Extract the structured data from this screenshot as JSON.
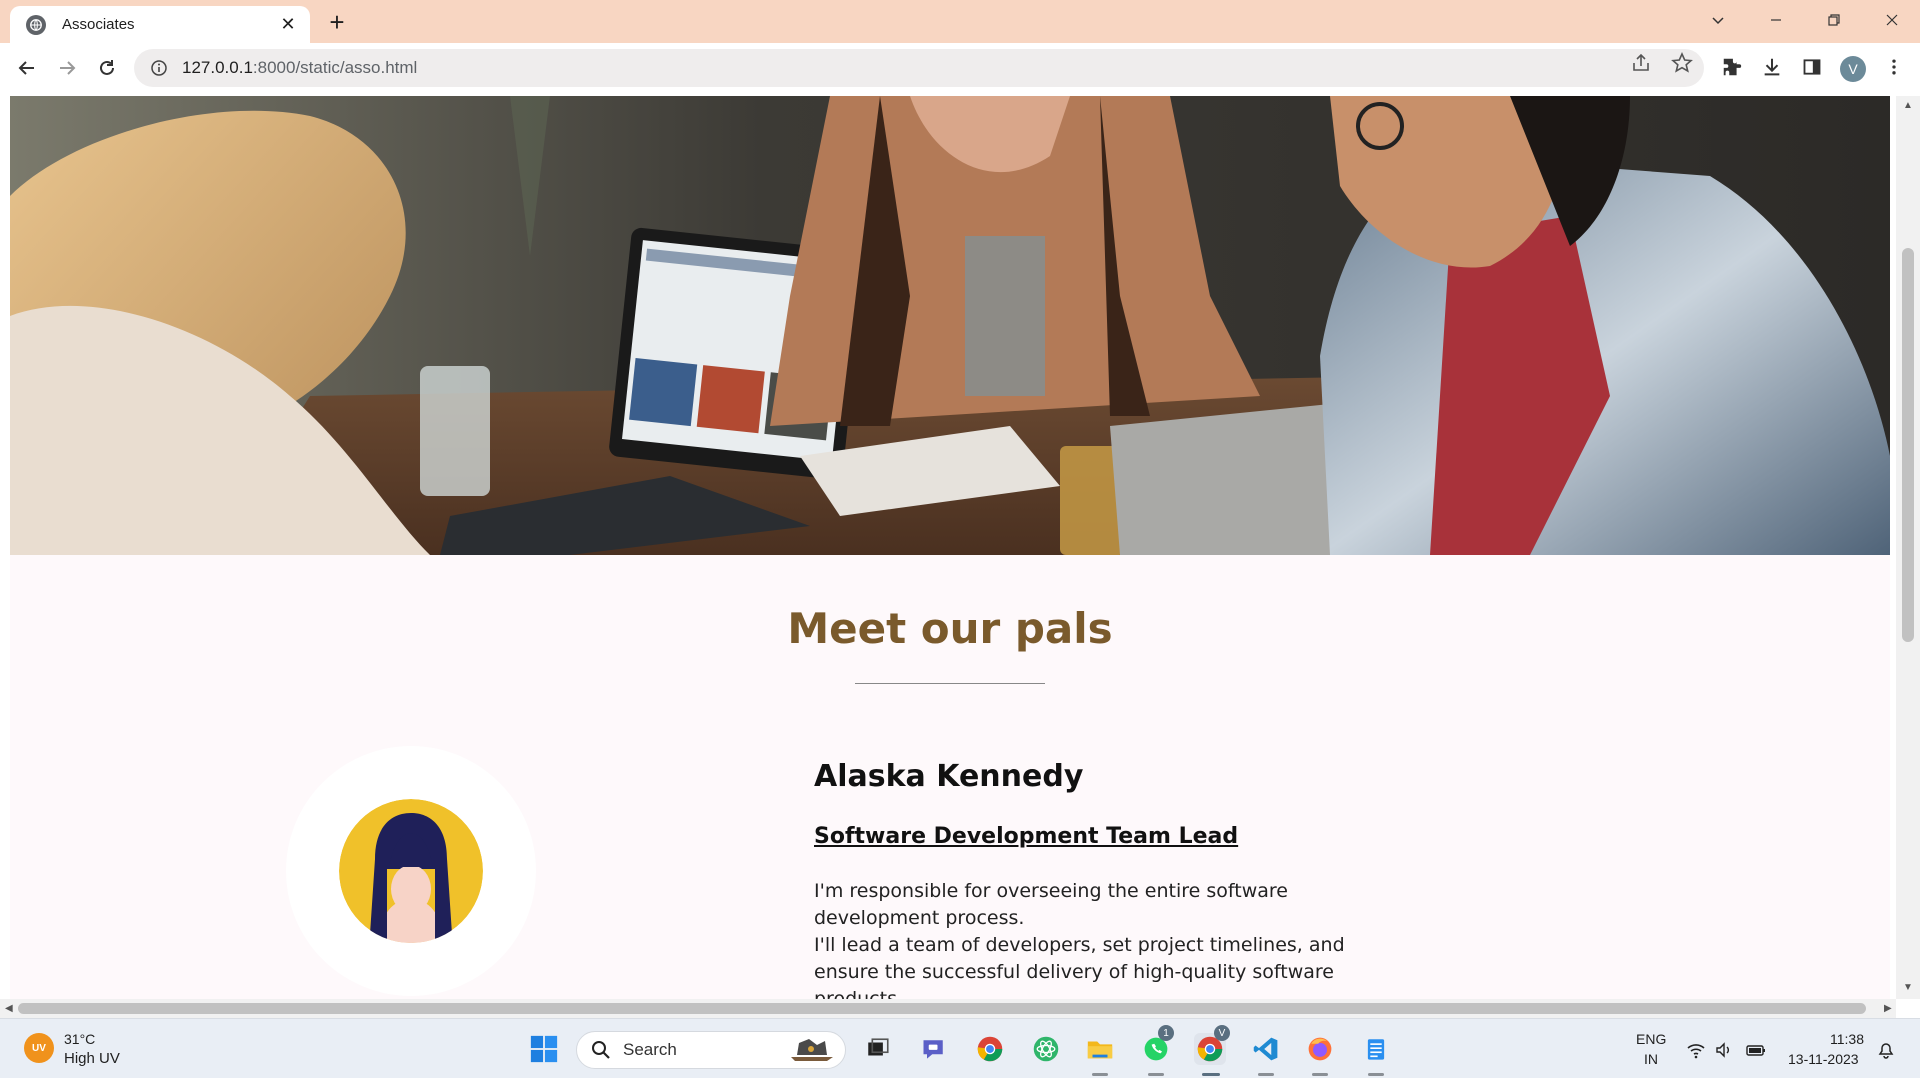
{
  "browser": {
    "tab_title": "Associates",
    "tab_close": "✕",
    "new_tab": "+",
    "url_host": "127.0.0.1",
    "url_path": ":8000/static/asso.html",
    "profile_initial": "V"
  },
  "page": {
    "section_title": "Meet our pals",
    "member": {
      "name": "Alaska Kennedy",
      "role": "Software Development Team Lead",
      "description_line1": "I'm responsible for overseeing the entire software development process.",
      "description_line2": "I'll lead a team of developers, set project timelines, and ensure the successful delivery of high-quality software products."
    }
  },
  "taskbar": {
    "weather_badge": "UV",
    "weather_temp": "31°C",
    "weather_desc": "High UV",
    "search_label": "Search",
    "whatsapp_badge": "1",
    "chrome_badge": "V",
    "lang_line1": "ENG",
    "lang_line2": "IN",
    "time": "11:38",
    "date": "13-11-2023"
  },
  "colors": {
    "tab_bar": "#f8d6c2",
    "title": "#7a5a2c",
    "page_bg": "#fef9fb",
    "avatar_yellow": "#f0c12a",
    "avatar_hair": "#1f2059"
  }
}
